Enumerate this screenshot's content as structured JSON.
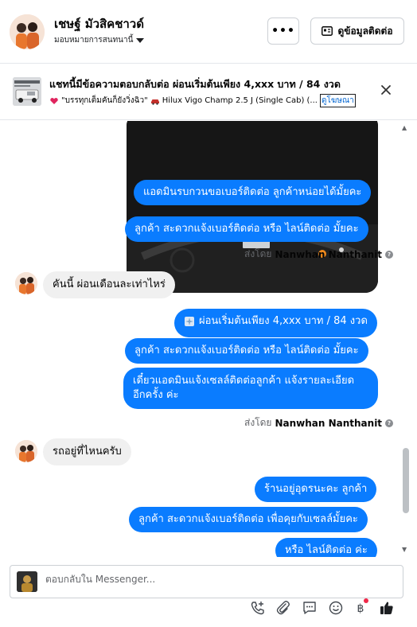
{
  "header": {
    "name": "เชษฐ์ มัวสิคชาวด์",
    "assigned": "มอบหมายการสนทนานี้",
    "more_label": "•••",
    "contact_label": "ดูข้อมูลติดต่อ"
  },
  "ad": {
    "title": "แชทนี้มีข้อความตอบกลับต่อ ผ่อนเริ่มต้นเพียง 4,xxx บาท / 84 งวด",
    "quote": "\"บรรทุกเต็มคันก็ยังวิ่งฉิว\"",
    "car": "Hilux Vigo Champ 2.5 J (Single Cab) (...",
    "link": "ดูโฆษณา"
  },
  "messages": {
    "m1": "แอดมินรบกวนขอเบอร์ติดต่อ ลูกค้าหน่อยได้มั้ยคะ",
    "m2": "ลูกค้า  สะดวกแจ้งเบอร์ติดต่อ หรือ ไลน์ติดต่อ มั้ยคะ",
    "sent1_prefix": "ส่งโดย",
    "sent1_name": "Nanwhan Nanthanit",
    "in1": "คันนี้ ผ่อนเดือนละเท่าไหร่",
    "m3": "ผ่อนเริ่มต้นเพียง 4,xxx บาท / 84 งวด",
    "m4": "ลูกค้า  สะดวกแจ้งเบอร์ติดต่อ หรือ ไลน์ติดต่อ มั้ยคะ",
    "m5_line1": "เดี๋ยวแอดมินแจ้งเซลล์ติดต่อลูกค้า  แจ้งรายละเอียด",
    "m5_line2": "อีกครั้ง ค่ะ",
    "sent2_prefix": "ส่งโดย",
    "sent2_name": "Nanwhan Nanthanit",
    "in2": "รถอยู่ที่ไหนครับ",
    "m6": "ร้านอยู่อุดรนะคะ  ลูกค้า",
    "m7": "ลูกค้า สะดวกแจ้งเบอร์ติดต่อ เพื่อคุยกับเซลล์มั้ยคะ",
    "m8": "หรือ ไลน์ติดต่อ ค่ะ"
  },
  "composer": {
    "placeholder": "ตอบกลับใน Messenger..."
  },
  "tools": [
    "phone-add-icon",
    "attachment-icon",
    "message-template-icon",
    "emoji-icon",
    "baht-payment-icon",
    "thumbs-up-icon"
  ],
  "colors": {
    "outgoing_bubble": "#0a7cff",
    "incoming_bubble": "#f0f0f0",
    "notification_dot": "#f02849"
  }
}
